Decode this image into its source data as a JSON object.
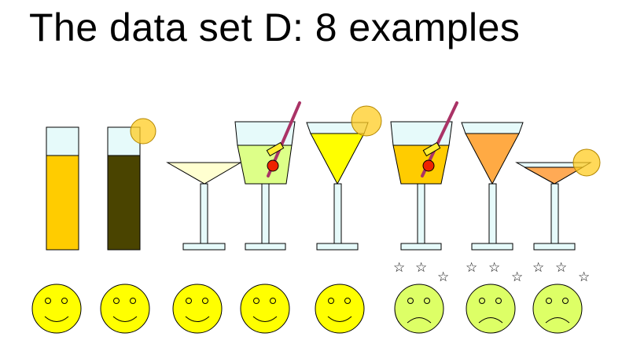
{
  "slide": {
    "title": "The data set D: 8 examples"
  },
  "examples": [
    {
      "drink": "tall-glass",
      "liquid_color": "#FFCC00",
      "lemon": false,
      "mood": "happy"
    },
    {
      "drink": "tall-glass",
      "liquid_color": "#4A4400",
      "lemon": true,
      "mood": "happy"
    },
    {
      "drink": "martini-glass",
      "liquid_color": "#FFFFD0",
      "lemon": false,
      "mood": "happy"
    },
    {
      "drink": "cocktail-glass",
      "liquid_color": "#DDFF88",
      "lemon": false,
      "straw": true,
      "olive": true,
      "mood": "happy"
    },
    {
      "drink": "cone-glass",
      "liquid_color": "#FFFF00",
      "lemon": true,
      "mood": "happy"
    },
    {
      "drink": "cocktail-glass",
      "liquid_color": "#FFCC00",
      "lemon": false,
      "straw": true,
      "olive": true,
      "mood": "sick"
    },
    {
      "drink": "cone-glass",
      "liquid_color": "#FFAA44",
      "lemon": false,
      "mood": "sick"
    },
    {
      "drink": "martini-glass",
      "liquid_color": "#FFAA55",
      "lemon": true,
      "mood": "sick"
    }
  ],
  "colors": {
    "glass_rim": "#E6FAFA",
    "lemon": "#FFCC22",
    "happy_face": "#FFFF00",
    "sick_face": "#DDFF66",
    "straw": "#AA3366",
    "olive": "#EE2200"
  }
}
